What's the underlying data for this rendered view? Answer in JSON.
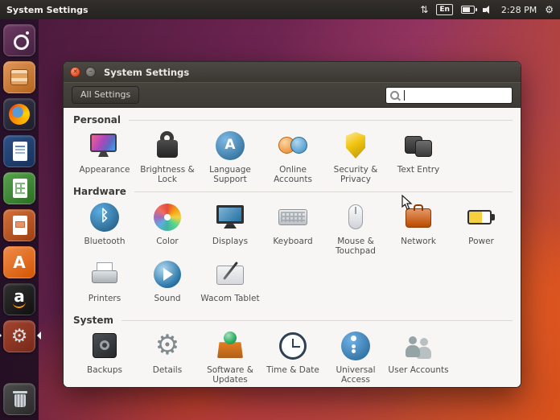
{
  "menubar": {
    "app_title": "System Settings",
    "language": "En",
    "time": "2:28 PM"
  },
  "launcher": {
    "items": [
      {
        "id": "dash",
        "icon": "ubuntu-dash-icon",
        "running": false,
        "focused": false
      },
      {
        "id": "files",
        "icon": "files-icon",
        "running": false,
        "focused": false
      },
      {
        "id": "firefox",
        "icon": "firefox-icon",
        "running": false,
        "focused": false
      },
      {
        "id": "writer",
        "icon": "libreoffice-writer-icon",
        "running": false,
        "focused": false
      },
      {
        "id": "calc",
        "icon": "libreoffice-calc-icon",
        "running": false,
        "focused": false
      },
      {
        "id": "impress",
        "icon": "libreoffice-impress-icon",
        "running": false,
        "focused": false
      },
      {
        "id": "software",
        "icon": "ubuntu-software-center-icon",
        "running": false,
        "focused": false
      },
      {
        "id": "amazon",
        "icon": "amazon-icon",
        "running": false,
        "focused": false
      },
      {
        "id": "settings",
        "icon": "system-settings-icon",
        "running": true,
        "focused": true
      },
      {
        "id": "trash",
        "icon": "trash-icon",
        "running": false,
        "focused": false
      }
    ]
  },
  "window": {
    "title": "System Settings",
    "toolbar": {
      "all_settings_label": "All Settings",
      "search_placeholder": ""
    },
    "sections": [
      {
        "title": "Personal",
        "items": [
          {
            "id": "appearance",
            "label": "Appearance",
            "icon": "appearance-icon"
          },
          {
            "id": "brightness-lock",
            "label": "Brightness & Lock",
            "icon": "brightness-lock-icon"
          },
          {
            "id": "language-support",
            "label": "Language Support",
            "icon": "language-support-icon"
          },
          {
            "id": "online-accounts",
            "label": "Online Accounts",
            "icon": "online-accounts-icon"
          },
          {
            "id": "security-privacy",
            "label": "Security & Privacy",
            "icon": "security-privacy-icon"
          },
          {
            "id": "text-entry",
            "label": "Text Entry",
            "icon": "text-entry-icon"
          }
        ]
      },
      {
        "title": "Hardware",
        "items": [
          {
            "id": "bluetooth",
            "label": "Bluetooth",
            "icon": "bluetooth-icon"
          },
          {
            "id": "color",
            "label": "Color",
            "icon": "color-icon"
          },
          {
            "id": "displays",
            "label": "Displays",
            "icon": "displays-icon"
          },
          {
            "id": "keyboard",
            "label": "Keyboard",
            "icon": "keyboard-icon"
          },
          {
            "id": "mouse-touchpad",
            "label": "Mouse & Touchpad",
            "icon": "mouse-touchpad-icon"
          },
          {
            "id": "network",
            "label": "Network",
            "icon": "network-icon"
          },
          {
            "id": "power",
            "label": "Power",
            "icon": "power-icon"
          },
          {
            "id": "printers",
            "label": "Printers",
            "icon": "printers-icon"
          },
          {
            "id": "sound",
            "label": "Sound",
            "icon": "sound-icon"
          },
          {
            "id": "wacom-tablet",
            "label": "Wacom Tablet",
            "icon": "wacom-tablet-icon"
          }
        ]
      },
      {
        "title": "System",
        "items": [
          {
            "id": "backups",
            "label": "Backups",
            "icon": "backups-icon"
          },
          {
            "id": "details",
            "label": "Details",
            "icon": "details-icon"
          },
          {
            "id": "software-updates",
            "label": "Software & Updates",
            "icon": "software-updates-icon"
          },
          {
            "id": "time-date",
            "label": "Time & Date",
            "icon": "time-date-icon"
          },
          {
            "id": "universal-access",
            "label": "Universal Access",
            "icon": "universal-access-icon"
          },
          {
            "id": "user-accounts",
            "label": "User Accounts",
            "icon": "user-accounts-icon"
          }
        ]
      }
    ]
  },
  "colors": {
    "accent_orange": "#dd4814",
    "wallpaper_purple": "#772953",
    "panel_dark": "#2c2a26",
    "content_bg": "#f7f6f4"
  }
}
